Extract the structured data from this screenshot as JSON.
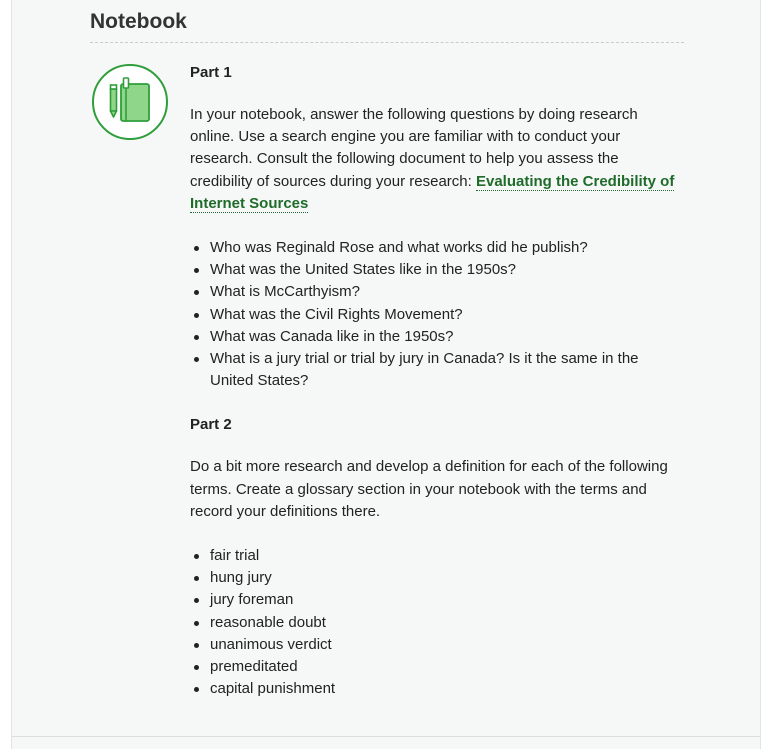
{
  "section_title": "Notebook",
  "icon": {
    "name": "notebook-pencil-icon",
    "accent": "#2f9e3a",
    "fill": "#8fd68a"
  },
  "colors": {
    "link": "#1f6b2a",
    "panel_bg": "#f6f8f8"
  },
  "part1": {
    "heading": "Part 1",
    "intro": "In your notebook, answer the following questions by doing research online. Use a search engine you are familiar with to conduct your research. Consult the following document to help you assess the credibility of sources during your research: ",
    "link_text": "Evaluating the Credibility of Internet Sources",
    "questions": [
      "Who was Reginald Rose and what works did he publish?",
      "What was the United States like in the 1950s?",
      "What is McCarthyism?",
      "What was the Civil Rights Movement?",
      "What was Canada like in the 1950s?",
      "What is a jury trial or trial by jury in Canada? Is it the same in the United States?"
    ]
  },
  "part2": {
    "heading": "Part 2",
    "intro": "Do a bit more research and develop a definition for each of the following terms. Create a glossary section in your notebook with the terms and record your definitions there.",
    "terms": [
      "fair trial",
      "hung jury",
      "jury foreman",
      "reasonable doubt",
      "unanimous verdict",
      "premeditated",
      "capital punishment"
    ]
  }
}
